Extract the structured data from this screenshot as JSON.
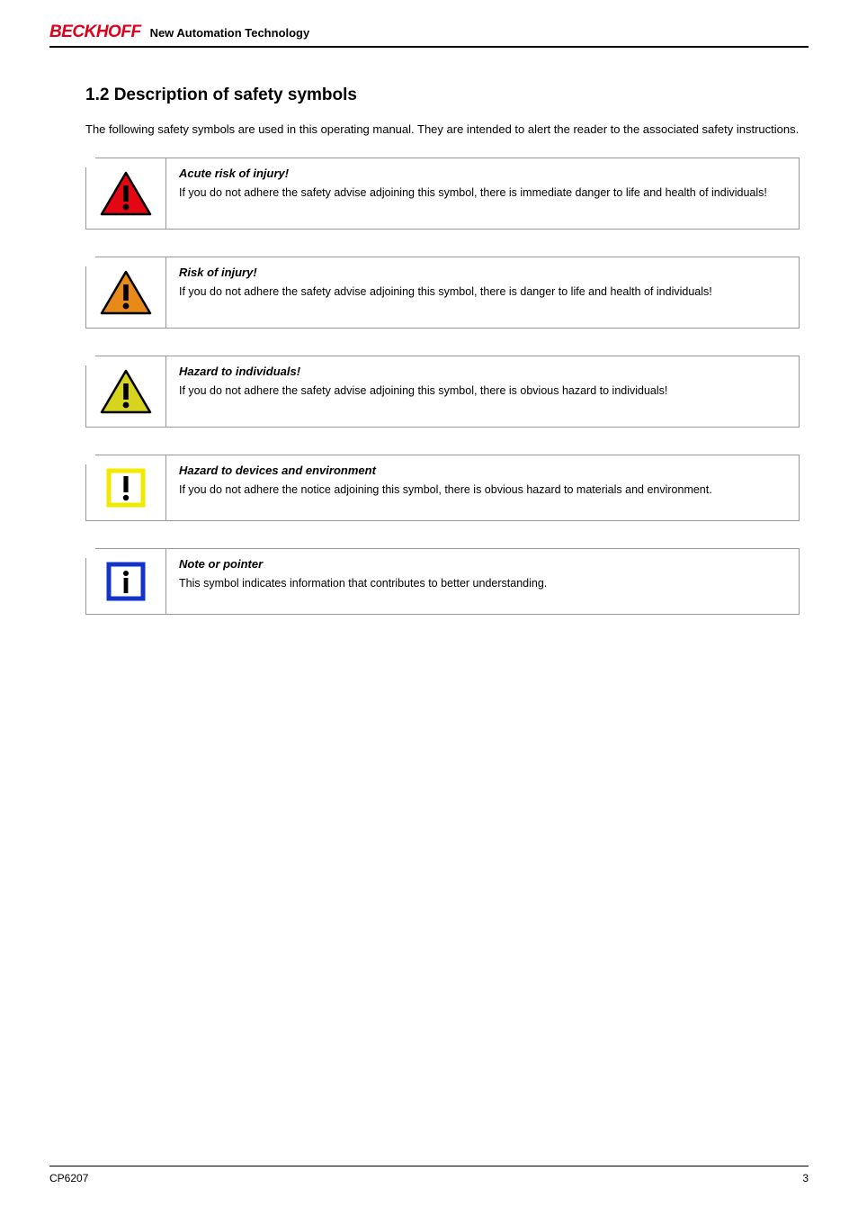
{
  "header": {
    "brand": "BECKHOFF",
    "tagline": "New Automation Technology"
  },
  "section": {
    "number": "1.2",
    "title": "Description of safety symbols",
    "heading": "1.2 Description of safety symbols",
    "intro": "The following safety symbols are used in this operating manual. They are intended to alert the reader to the associated safety instructions."
  },
  "notices": [
    {
      "icon": "danger-triangle-red",
      "title": "Acute risk of injury!",
      "body": "If you do not adhere the safety advise adjoining this symbol, there is immediate danger to life and health of individuals!"
    },
    {
      "icon": "warning-triangle-orange",
      "title": "Risk of injury!",
      "body": "If you do not adhere the safety advise adjoining this symbol, there is danger to life and health of individuals!"
    },
    {
      "icon": "caution-triangle-yellow",
      "title": "Hazard to individuals!",
      "body": "If you do not adhere the safety advise adjoining this symbol, there is obvious hazard to individuals!"
    },
    {
      "icon": "attention-square-yellow",
      "title": "Hazard to devices and environment",
      "body": "If you do not adhere the notice adjoining this symbol, there is obvious hazard to materials and environment."
    },
    {
      "icon": "info-square-blue",
      "title": "Note or pointer",
      "body": "This symbol indicates information that contributes to better understanding."
    }
  ],
  "footer": {
    "left": "CP6207",
    "right": "3"
  }
}
